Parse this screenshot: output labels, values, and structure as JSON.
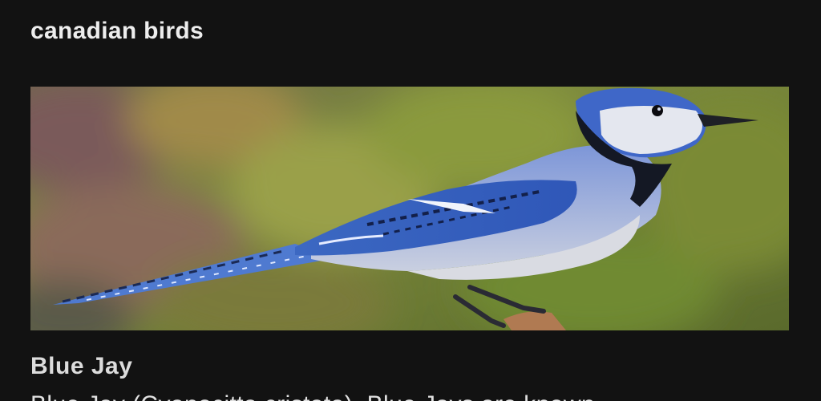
{
  "header": {
    "title": "canadian birds"
  },
  "card": {
    "image_alt": "Blue Jay",
    "name": "Blue Jay",
    "description": "Blue Jay (Cyanocitta cristata). Blue Jays are known"
  },
  "colors": {
    "background": "#121212",
    "title_text": "#ededed",
    "heading_text": "#dcdcdc"
  }
}
